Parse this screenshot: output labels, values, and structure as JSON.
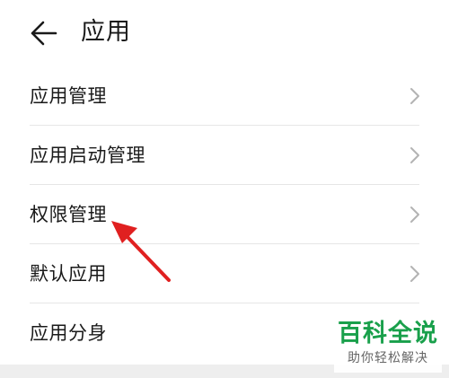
{
  "header": {
    "back_icon": "arrow-left-icon",
    "title": "应用"
  },
  "menu": {
    "items": [
      {
        "label": "应用管理",
        "icon": "chevron-right-icon"
      },
      {
        "label": "应用启动管理",
        "icon": "chevron-right-icon"
      },
      {
        "label": "权限管理",
        "icon": "chevron-right-icon"
      },
      {
        "label": "默认应用",
        "icon": "chevron-right-icon"
      },
      {
        "label": "应用分身",
        "icon": "chevron-right-icon"
      }
    ]
  },
  "annotation": {
    "icon": "red-arrow-pointer",
    "color": "#e02020"
  },
  "watermark": {
    "main": "百科全说",
    "sub": "助你轻松解决",
    "color": "#19a04b"
  }
}
